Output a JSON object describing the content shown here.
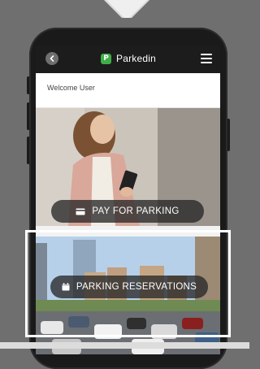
{
  "header": {
    "brand_name": "Parkedin",
    "logo_letter": "P"
  },
  "welcome": {
    "text": "Welcome User"
  },
  "actions": [
    {
      "label": "PAY FOR PARKING",
      "icon": "credit-card-icon"
    },
    {
      "label": "PARKING RESERVATIONS",
      "icon": "calendar-icon"
    }
  ],
  "colors": {
    "brand_green": "#3fae49",
    "topbar": "#1c1c1c",
    "backdrop": "#6f6f6f"
  }
}
